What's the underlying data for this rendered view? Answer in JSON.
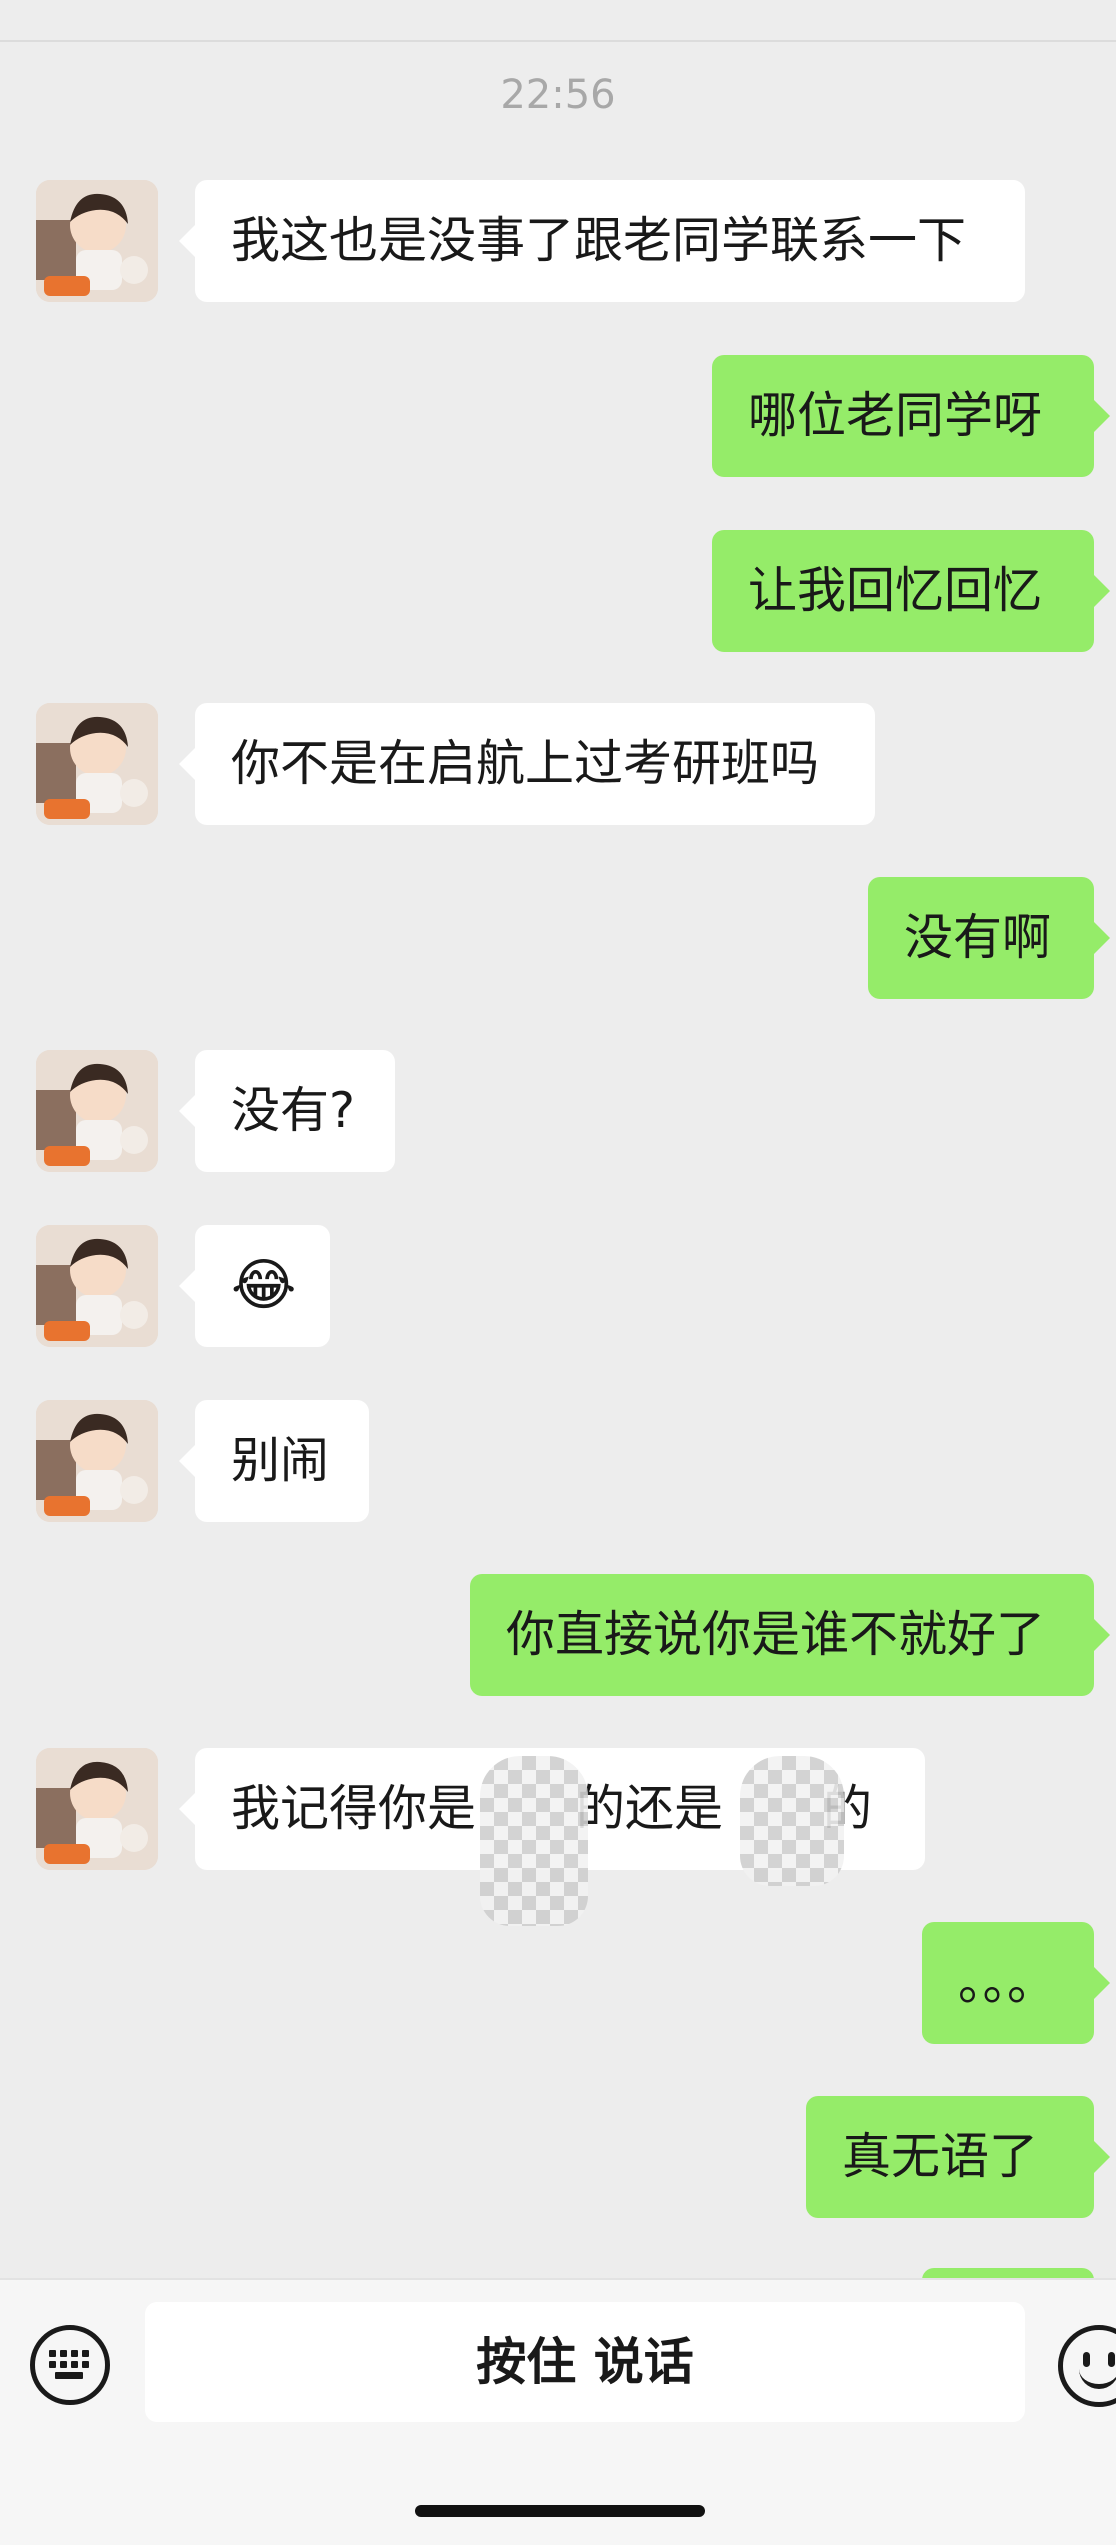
{
  "header": {
    "timestamp": "22:56"
  },
  "messages": [
    {
      "side": "in",
      "text": "我这也是没事了跟老同学联系一下"
    },
    {
      "side": "out",
      "text": "哪位老同学呀"
    },
    {
      "side": "out",
      "text": "让我回忆回忆"
    },
    {
      "side": "in",
      "text": "你不是在启航上过考研班吗"
    },
    {
      "side": "out",
      "text": "没有啊"
    },
    {
      "side": "in",
      "text": "没有?"
    },
    {
      "side": "in",
      "text": "😂"
    },
    {
      "side": "in",
      "text": "别闹"
    },
    {
      "side": "out",
      "text": "你直接说你是谁不就好了"
    },
    {
      "side": "in",
      "parts": [
        "我记得你是",
        "的还是",
        "的"
      ]
    },
    {
      "side": "out",
      "text": "。。。"
    },
    {
      "side": "out",
      "text": "真无语了"
    }
  ],
  "input_bar": {
    "hold_to_talk_label": "按住 说话",
    "left_icon": "keyboard-icon",
    "right_icon": "emoji-icon"
  },
  "colors": {
    "outgoing_bubble": "#95ec69",
    "incoming_bubble": "#ffffff",
    "background": "#ededed"
  }
}
